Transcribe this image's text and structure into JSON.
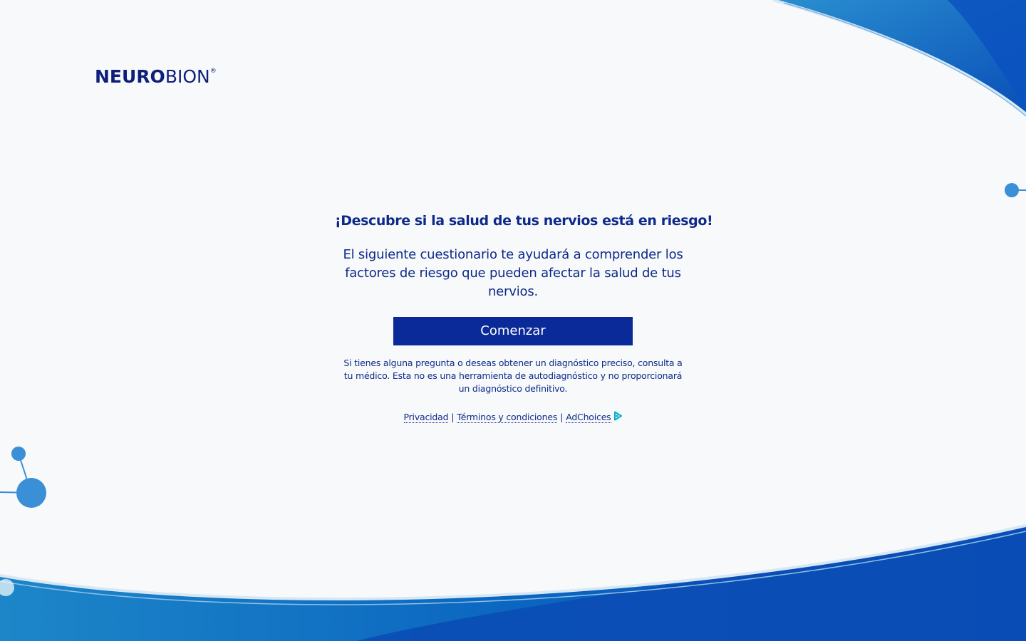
{
  "brand": {
    "logo_bold": "NEURO",
    "logo_light": "BION",
    "logo_mark": "®"
  },
  "main": {
    "headline": "¡Descubre si la salud de tus nervios está en riesgo!",
    "intro": "El siguiente cuestionario te ayudará a comprender los factores de riesgo que pueden afectar la salud de tus nervios.",
    "start_button": "Comenzar",
    "disclaimer": "Si tienes alguna pregunta o deseas obtener un diagnóstico preciso, consulta a tu médico. Esta no es una herramienta de autodiagnóstico y no proporcionará un diagnóstico definitivo."
  },
  "footer": {
    "links": [
      "Privacidad",
      "Términos y condiciones",
      "AdChoices"
    ],
    "separator": "|",
    "adchoices_icon": "adchoices-icon"
  },
  "colors": {
    "brand_navy": "#0d2a8a",
    "button_bg": "#0b2a99",
    "accent_blue": "#1a5fc4",
    "light_blue": "#3a8fd6"
  }
}
